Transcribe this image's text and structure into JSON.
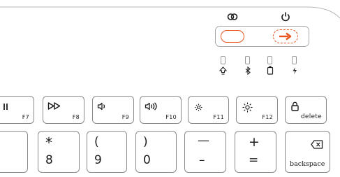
{
  "status_panel": {
    "top_icons": [
      "link-icon",
      "power-icon"
    ],
    "toggle_left_icon": "pill-outline-icon",
    "toggle_right_icon": "arrow-right-icon",
    "accent_color": "#e8541c",
    "indicators": [
      "caps-lock-icon",
      "bluetooth-icon",
      "battery-icon",
      "charging-icon"
    ]
  },
  "function_keys": [
    {
      "icon": "pause-icon",
      "label": "F7"
    },
    {
      "icon": "fast-forward-icon",
      "label": "F8"
    },
    {
      "icon": "volume-down-icon",
      "label": "F9"
    },
    {
      "icon": "volume-up-icon",
      "label": "F10"
    },
    {
      "icon": "brightness-down-icon",
      "label": "F11"
    },
    {
      "icon": "brightness-up-icon",
      "label": "F12"
    },
    {
      "icon": "lock-icon",
      "label": "delete"
    }
  ],
  "number_keys": [
    {
      "top": "*",
      "bottom": "8"
    },
    {
      "top": "(",
      "bottom": "9"
    },
    {
      "top": ")",
      "bottom": "0"
    },
    {
      "top": "—",
      "bottom": "–"
    },
    {
      "top": "+",
      "bottom": "="
    }
  ],
  "backspace_key": {
    "icon": "backspace-icon",
    "label": "backspace"
  }
}
